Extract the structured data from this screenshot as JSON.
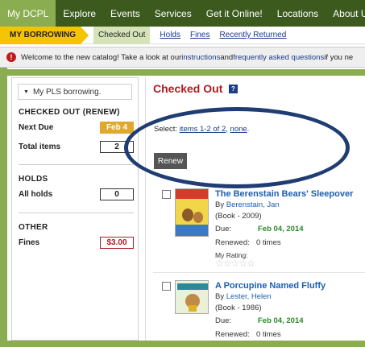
{
  "nav": {
    "items": [
      "My DCPL",
      "Explore",
      "Events",
      "Services",
      "Get it Online!",
      "Locations",
      "About Us"
    ]
  },
  "subnav": {
    "crumb": "MY BORROWING",
    "items": [
      "Checked Out",
      "Holds",
      "Fines",
      "Recently Returned"
    ]
  },
  "notice": {
    "pre": "Welcome to the new catalog! Take a look at our ",
    "link1": "instructions",
    "mid": " and ",
    "link2": "frequently asked questions",
    "post": " if you ne"
  },
  "sidebar": {
    "header": "My PLS borrowing.",
    "checked_out_title": "CHECKED OUT (RENEW)",
    "next_due_label": "Next Due",
    "next_due_value": "Feb 4",
    "total_items_label": "Total items",
    "total_items_value": "2",
    "holds_title": "HOLDS",
    "all_holds_label": "All holds",
    "all_holds_value": "0",
    "other_title": "OTHER",
    "fines_label": "Fines",
    "fines_value": "$3.00"
  },
  "main": {
    "title": "Checked Out",
    "help": "?",
    "select_label": "Select: ",
    "select_items": "items 1-2 of 2",
    "select_sep": ", ",
    "select_none": "none",
    "select_end": ".",
    "renew_label": "Renew",
    "books": [
      {
        "title": "The Berenstain Bears' Sleepover",
        "by": "By ",
        "author": "Berenstain, Jan",
        "format": "(Book - 2009)",
        "due_label": "Due:",
        "due_date": "Feb 04, 2014",
        "renewed_label": "Renewed:",
        "renewed_value": "0 times",
        "rating_label": "My Rating:",
        "stars": "☆☆☆☆☆"
      },
      {
        "title": "A Porcupine Named Fluffy",
        "by": "By ",
        "author": "Lester, Helen",
        "format": "(Book - 1986)",
        "due_label": "Due:",
        "due_date": "Feb 04, 2014",
        "renewed_label": "Renewed:",
        "renewed_value": "0 times"
      }
    ]
  },
  "colors": {
    "nav_bg": "#3d5a1e",
    "nav_active": "#8aad52",
    "crumb": "#f5c400",
    "title_red": "#b01c22",
    "link_blue": "#1a5fb4",
    "due_green": "#2a8a2a",
    "annotation_oval": "#1f3d73"
  }
}
